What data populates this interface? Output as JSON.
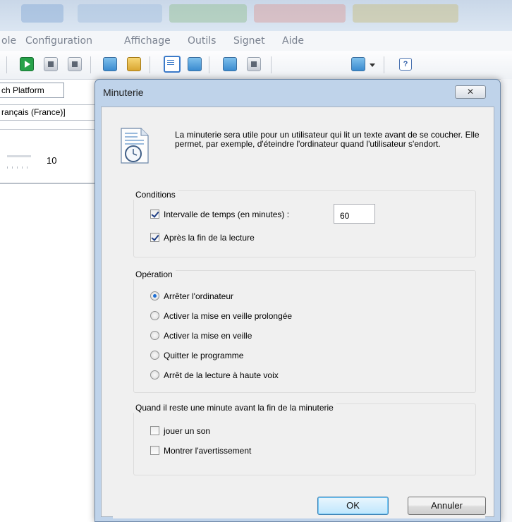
{
  "app": {
    "menu": [
      "ole",
      "Configuration",
      "Affichage",
      "Outils",
      "Signet",
      "Aide"
    ],
    "tab_label": "ch Platform",
    "language_value": "rançais (France)]",
    "speed_value": "10"
  },
  "dialog": {
    "title": "Minuterie",
    "close_glyph": "✕",
    "intro": "La minuterie sera utile pour un utilisateur qui lit un texte avant de se coucher. Elle permet, par exemple, d'éteindre l'ordinateur quand l'utilisateur s'endort.",
    "conditions": {
      "legend": "Conditions",
      "interval": {
        "label": "Intervalle de temps (en minutes) :",
        "checked": true,
        "value": "60"
      },
      "after_reading": {
        "label": "Après la fin de la lecture",
        "checked": true
      }
    },
    "operation": {
      "legend": "Opération",
      "selected": 0,
      "options": [
        "Arrêter l'ordinateur",
        "Activer la mise en veille prolongée",
        "Activer la mise en veille",
        "Quitter le programme",
        "Arrêt de la lecture à haute voix"
      ]
    },
    "last_minute": {
      "legend": "Quand il reste une minute avant la fin de la minuterie",
      "play_sound": {
        "label": "jouer un son",
        "checked": false
      },
      "show_warning": {
        "label": "Montrer l'avertissement",
        "checked": false
      }
    },
    "buttons": {
      "ok": "OK",
      "cancel": "Annuler"
    }
  }
}
